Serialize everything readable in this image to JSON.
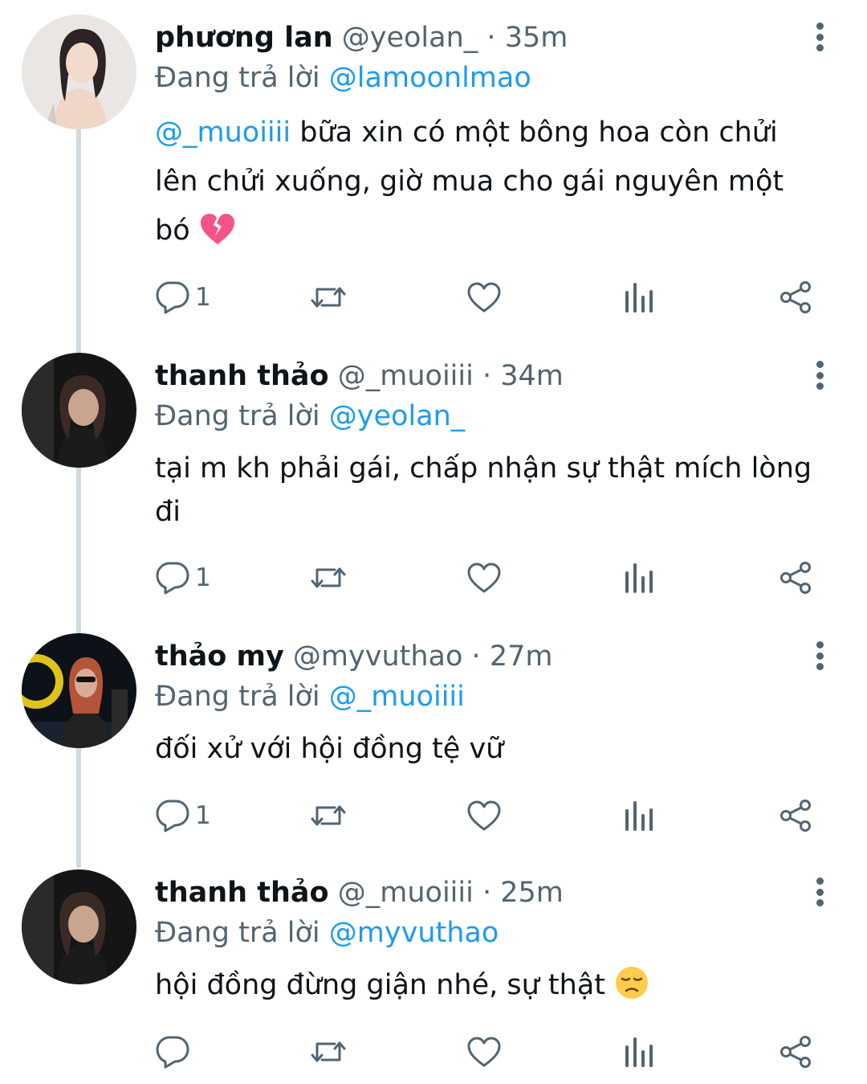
{
  "thread": [
    {
      "name": "phương lan",
      "handle": "@yeolan_",
      "separator": "·",
      "time": "35m",
      "reply_prefix": "Đang trả lời",
      "reply_to": "@lamoonlmao",
      "mention": "@_muoiiii",
      "text_lines": [
        "bữa xin có một bông hoa còn chửi",
        "lên chửi xuống, giờ mua cho gái nguyên một",
        "bó"
      ],
      "emoji": "broken-heart",
      "reply_count": "1",
      "avatar_style": "light"
    },
    {
      "name": "thanh thảo",
      "handle": "@_muoiiii",
      "separator": "·",
      "time": "34m",
      "reply_prefix": "Đang trả lời",
      "reply_to": "@yeolan_",
      "text_lines": [
        "tại m kh phải gái, chấp nhận sự thật mích lòng",
        "đi"
      ],
      "reply_count": "1",
      "avatar_style": "dark"
    },
    {
      "name": "thảo my",
      "handle": "@myvuthao",
      "separator": "·",
      "time": "27m",
      "reply_prefix": "Đang trả lời",
      "reply_to": "@_muoiiii",
      "text_lines": [
        "đối xử với hội đồng tệ vữ"
      ],
      "reply_count": "1",
      "avatar_style": "stage"
    },
    {
      "name": "thanh thảo",
      "handle": "@_muoiiii",
      "separator": "·",
      "time": "25m",
      "reply_prefix": "Đang trả lời",
      "reply_to": "@myvuthao",
      "text_lines": [
        "hội đồng đừng giận nhé, sự thật"
      ],
      "emoji": "disappointed-face",
      "reply_count": "",
      "avatar_style": "dark"
    }
  ],
  "icons": [
    "reply-icon",
    "retweet-icon",
    "like-icon",
    "analytics-icon",
    "share-icon",
    "more-icon"
  ],
  "colors": {
    "text": "#0f1419",
    "secondary": "#536471",
    "link": "#1d9bf0",
    "thread_line": "#cfd9de",
    "broken_heart": "#f4538a",
    "emoji_face": "#ffcc4d"
  }
}
